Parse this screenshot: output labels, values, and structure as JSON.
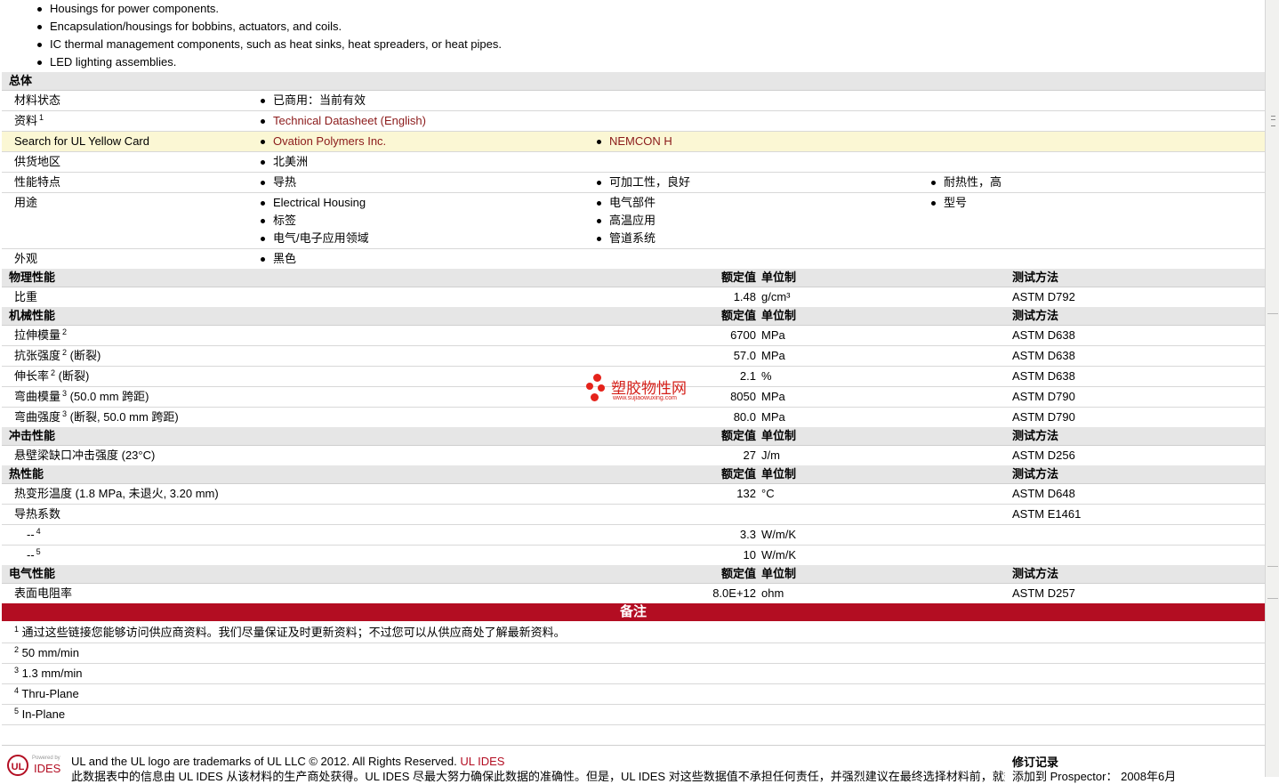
{
  "intro_items": [
    "Housings for power components.",
    "Encapsulation/housings for bobbins, actuators, and coils.",
    "IC thermal management components, such as heat sinks, heat spreaders, or heat pipes.",
    "LED lighting assemblies."
  ],
  "general": {
    "title": "总体",
    "material_status": {
      "label": "材料状态",
      "value": "已商用：当前有效"
    },
    "documents": {
      "label": "资料",
      "sup": "1",
      "value": "Technical Datasheet (English)"
    },
    "ul_card": {
      "label": "Search for UL Yellow Card",
      "values": [
        "Ovation Polymers Inc.",
        "NEMCON H"
      ]
    },
    "region": {
      "label": "供货地区",
      "value": "北美洲"
    },
    "features": {
      "label": "性能特点",
      "values": [
        "导热",
        "可加工性，良好",
        "耐热性，高"
      ]
    },
    "uses": {
      "label": "用途",
      "col1": [
        "Electrical Housing",
        "标签",
        "电气/电子应用领域"
      ],
      "col2": [
        "电气部件",
        "高温应用",
        "管道系统"
      ],
      "col3": [
        "型号"
      ]
    },
    "appearance": {
      "label": "外观",
      "value": "黑色"
    }
  },
  "headers": {
    "nominal": "额定值",
    "units": "单位制",
    "method": "测试方法"
  },
  "physical": {
    "title": "物理性能",
    "rows": [
      {
        "label": "比重",
        "value": "1.48",
        "unit": "g/cm³",
        "method": "ASTM D792"
      }
    ]
  },
  "mechanical": {
    "title": "机械性能",
    "rows": [
      {
        "label": "拉伸模量",
        "sup": "2",
        "cond": "",
        "value": "6700",
        "unit": "MPa",
        "method": "ASTM D638"
      },
      {
        "label": "抗张强度",
        "sup": "2",
        "cond": "(断裂)",
        "value": "57.0",
        "unit": "MPa",
        "method": "ASTM D638"
      },
      {
        "label": "伸长率",
        "sup": "2",
        "cond": "(断裂)",
        "value": "2.1",
        "unit": "%",
        "method": "ASTM D638"
      },
      {
        "label": "弯曲模量",
        "sup": "3",
        "cond": "(50.0 mm 跨距)",
        "value": "8050",
        "unit": "MPa",
        "method": "ASTM D790"
      },
      {
        "label": "弯曲强度",
        "sup": "3",
        "cond": "(断裂, 50.0 mm 跨距)",
        "value": "80.0",
        "unit": "MPa",
        "method": "ASTM D790"
      }
    ]
  },
  "impact": {
    "title": "冲击性能",
    "rows": [
      {
        "label": "悬壁梁缺口冲击强度  (23°C)",
        "value": "27",
        "unit": "J/m",
        "method": "ASTM D256"
      }
    ]
  },
  "thermal": {
    "title": "热性能",
    "hdt": {
      "label": "热变形温度  (1.8 MPa, 未退火, 3.20 mm)",
      "value": "132",
      "unit": "°C",
      "method": "ASTM D648"
    },
    "conductivity": {
      "label": "导热系数",
      "method": "ASTM E1461"
    },
    "sub": [
      {
        "label": "--",
        "sup": "4",
        "value": "3.3",
        "unit": "W/m/K"
      },
      {
        "label": "--",
        "sup": "5",
        "value": "10",
        "unit": "W/m/K"
      }
    ]
  },
  "electrical": {
    "title": "电气性能",
    "rows": [
      {
        "label": "表面电阻率",
        "value": "8.0E+12",
        "unit": "ohm",
        "method": "ASTM D257"
      }
    ]
  },
  "notes": {
    "title": "备注",
    "items": [
      {
        "n": "1",
        "text": "通过这些链接您能够访问供应商资料。我们尽量保证及时更新资料；不过您可以从供应商处了解最新资料。"
      },
      {
        "n": "2",
        "text": "50 mm/min"
      },
      {
        "n": "3",
        "text": "1.3 mm/min"
      },
      {
        "n": "4",
        "text": "Thru-Plane"
      },
      {
        "n": "5",
        "text": "In-Plane"
      }
    ]
  },
  "watermark": {
    "text": "塑胶物性网",
    "url": "www.sujiaowuxing.com"
  },
  "footer": {
    "logo": "UL",
    "powered": "Powered by",
    "ides": "IDES",
    "trademark": "UL and the UL logo are trademarks of UL LLC © 2012. All Rights Reserved.",
    "trademark_link": "UL IDES",
    "disclaimer": "此数据表中的信息由 UL IDES 从该材料的生产商处获得。UL IDES 尽最大努力确保此数据的准确性。但是，UL IDES 对这些数据值不承担任何责任，并强烈建议在最终选择材料前，就数",
    "revision_title": "修订记录",
    "revision_line": "添加到 Prospector： 2008年6月"
  },
  "colors": {
    "accent": "#b30d22",
    "link": "#8b1a1a",
    "highlight": "#fbf7d4",
    "section": "#e6e6e6"
  }
}
